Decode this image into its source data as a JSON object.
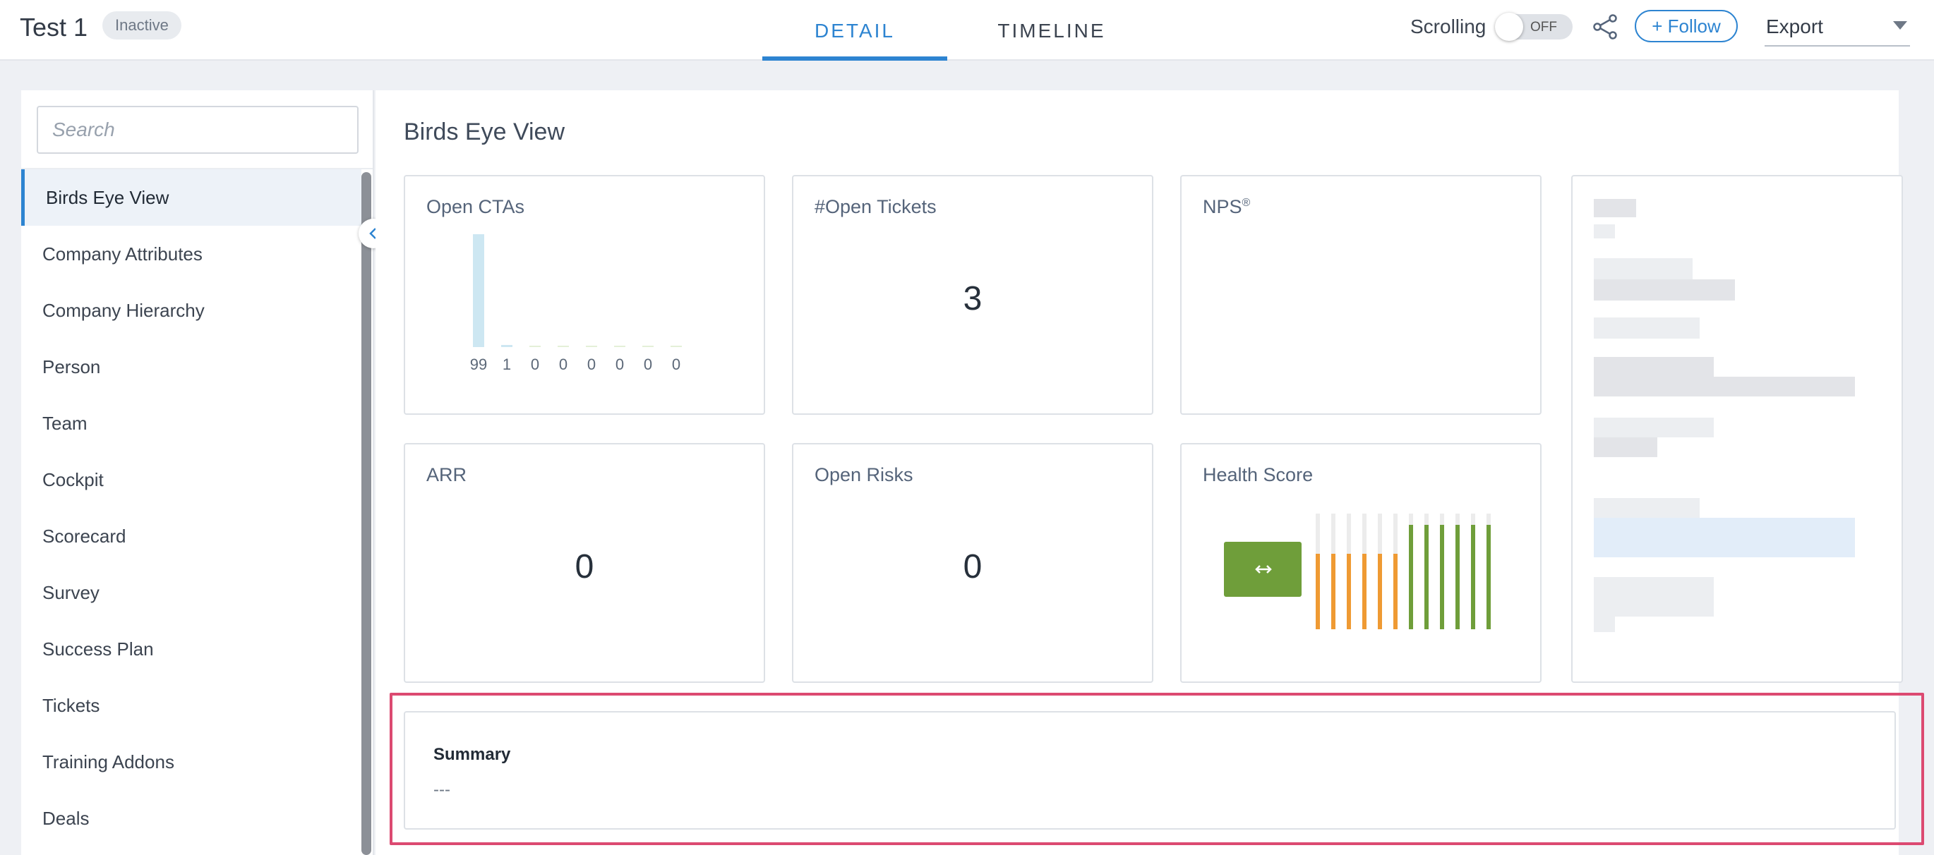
{
  "header": {
    "title": "Test 1",
    "status_badge": "Inactive",
    "tabs": [
      {
        "label": "DETAIL",
        "active": true
      },
      {
        "label": "TIMELINE",
        "active": false
      }
    ],
    "scrolling_label": "Scrolling",
    "scrolling_state": "OFF",
    "follow_label": "Follow",
    "export_label": "Export",
    "accent_color": "#2d84d1"
  },
  "sidebar": {
    "search_placeholder": "Search",
    "items": [
      {
        "label": "Birds Eye View",
        "active": true
      },
      {
        "label": "Company Attributes"
      },
      {
        "label": "Company Hierarchy"
      },
      {
        "label": "Person"
      },
      {
        "label": "Team"
      },
      {
        "label": "Cockpit"
      },
      {
        "label": "Scorecard"
      },
      {
        "label": "Survey"
      },
      {
        "label": "Success Plan"
      },
      {
        "label": "Tickets"
      },
      {
        "label": "Training Addons"
      },
      {
        "label": "Deals"
      }
    ]
  },
  "main": {
    "section_title": "Birds Eye View",
    "cards": {
      "open_ctas": {
        "title": "Open CTAs"
      },
      "open_tickets": {
        "title": "#Open Tickets",
        "value": "3"
      },
      "nps": {
        "title": "NPS",
        "sup": "®"
      },
      "arr": {
        "title": "ARR",
        "value": "0"
      },
      "open_risks": {
        "title": "Open Risks",
        "value": "0"
      },
      "health_score": {
        "title": "Health Score",
        "trend_icon": "left-right-arrow-icon",
        "color": "#6f9e3a"
      }
    },
    "summary": {
      "title": "Summary",
      "value": "---"
    }
  },
  "chart_data": [
    {
      "type": "bar",
      "title": "Open CTAs",
      "categories": [
        "",
        "",
        "",
        "",
        "",
        "",
        "",
        ""
      ],
      "values": [
        99,
        1,
        0,
        0,
        0,
        0,
        0,
        0
      ],
      "data_labels": [
        "99",
        "1",
        "0",
        "0",
        "0",
        "0",
        "0",
        "0"
      ],
      "color": "#cde7f2"
    },
    {
      "type": "bar",
      "title": "Health Score",
      "series": [
        {
          "values": [
            65,
            65,
            65,
            65,
            65,
            65,
            90,
            90,
            90,
            90,
            90,
            90
          ],
          "colors": [
            "#ef9a33",
            "#ef9a33",
            "#ef9a33",
            "#ef9a33",
            "#ef9a33",
            "#ef9a33",
            "#6f9e3a",
            "#6f9e3a",
            "#6f9e3a",
            "#6f9e3a",
            "#6f9e3a",
            "#6f9e3a"
          ]
        }
      ],
      "ylim": [
        0,
        100
      ]
    }
  ]
}
